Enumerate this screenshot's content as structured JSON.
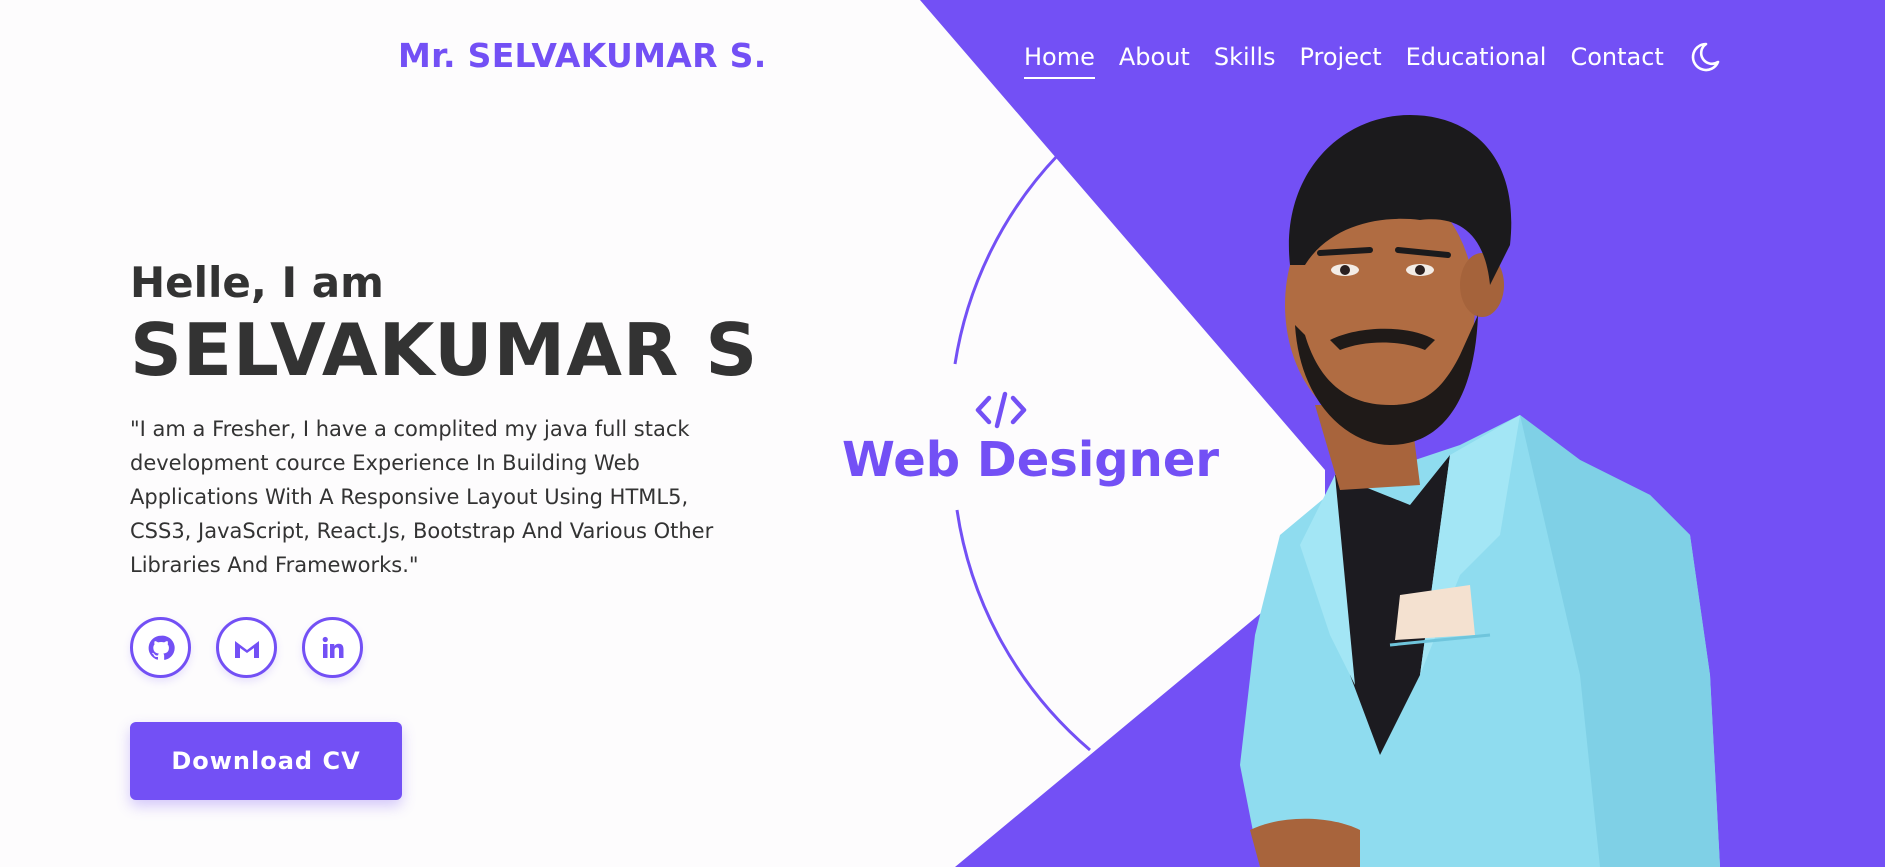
{
  "header": {
    "brand": "Mr. SELVAKUMAR S.",
    "nav": [
      {
        "label": "Home",
        "active": true
      },
      {
        "label": "About"
      },
      {
        "label": "Skills"
      },
      {
        "label": "Project"
      },
      {
        "label": "Educational"
      },
      {
        "label": "Contact"
      }
    ],
    "theme_icon": "moon-icon"
  },
  "hero": {
    "greeting": "Helle, I am",
    "name": "SELVAKUMAR S",
    "description": "\"I am a Fresher, I have a complited my java full stack development cource Experience In Building Web Applications With A Responsive Layout Using HTML5, CSS3, JavaScript, React.Js, Bootstrap And Various Other Libraries And Frameworks.\"",
    "socials": [
      "github-icon",
      "gmail-icon",
      "linkedin-icon"
    ],
    "download_label": "Download CV"
  },
  "badge": {
    "icon": "code-icon",
    "role": "Web Designer"
  },
  "colors": {
    "accent": "#7350f5",
    "text": "#333333",
    "background": "#fdfcfd",
    "jacket": "#8fdcef"
  }
}
